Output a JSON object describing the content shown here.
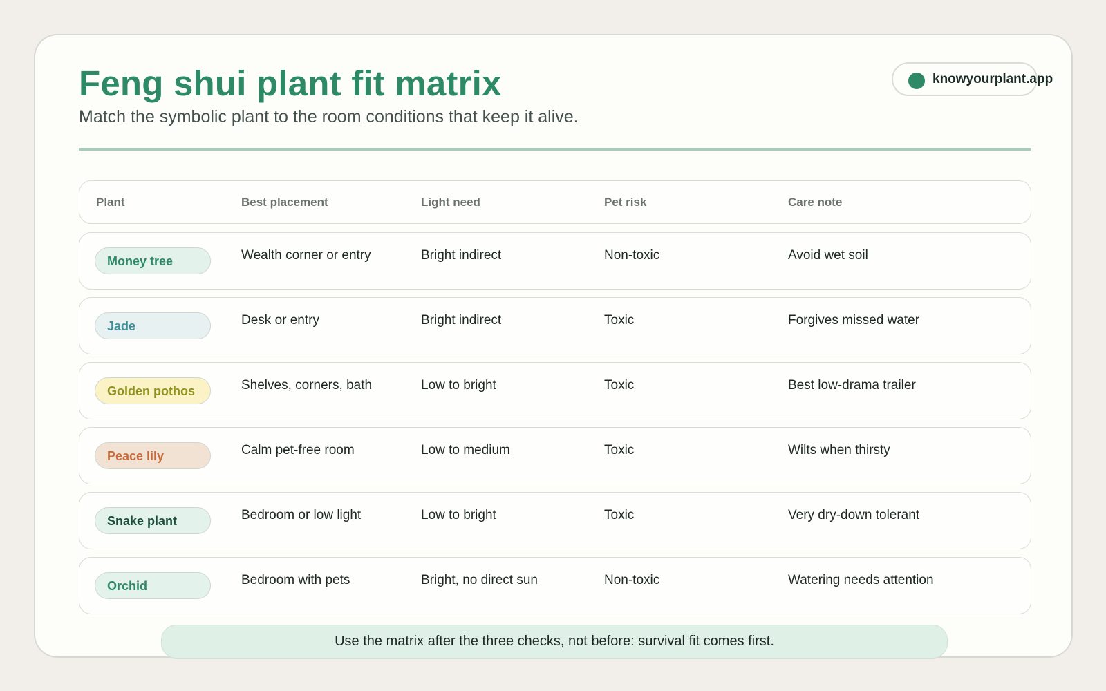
{
  "header": {
    "title": "Feng shui plant fit matrix",
    "subtitle": "Match the symbolic plant to the room conditions that keep it alive."
  },
  "brand": {
    "label": "knowyourplant.app",
    "dot_color": "#2e8a66"
  },
  "table": {
    "columns": [
      "Plant",
      "Best placement",
      "Light need",
      "Pet risk",
      "Care note"
    ],
    "rows": [
      {
        "plant": "Money tree",
        "placement": "Wealth corner or entry",
        "light": "Bright indirect",
        "pet_risk": "Non-toxic",
        "care": "Avoid wet soil",
        "pill_bg": "#e3f2ea",
        "pill_text": "#2e8a66"
      },
      {
        "plant": "Jade",
        "placement": "Desk or entry",
        "light": "Bright indirect",
        "pet_risk": "Toxic",
        "care": "Forgives missed water",
        "pill_bg": "#e8f1f2",
        "pill_text": "#3f8e98"
      },
      {
        "plant": "Golden pothos",
        "placement": "Shelves, corners, bath",
        "light": "Low to bright",
        "pet_risk": "Toxic",
        "care": "Best low-drama trailer",
        "pill_bg": "#fbf3c6",
        "pill_text": "#8e931f"
      },
      {
        "plant": "Peace lily",
        "placement": "Calm pet-free room",
        "light": "Low to medium",
        "pet_risk": "Toxic",
        "care": "Wilts when thirsty",
        "pill_bg": "#f2e2d4",
        "pill_text": "#c86a3a"
      },
      {
        "plant": "Snake plant",
        "placement": "Bedroom or low light",
        "light": "Low to bright",
        "pet_risk": "Toxic",
        "care": "Very dry-down tolerant",
        "pill_bg": "#e3f2ea",
        "pill_text": "#1b4d38"
      },
      {
        "plant": "Orchid",
        "placement": "Bedroom with pets",
        "light": "Bright, no direct sun",
        "pet_risk": "Non-toxic",
        "care": "Watering needs attention",
        "pill_bg": "#e3f2ea",
        "pill_text": "#2e8a66"
      }
    ]
  },
  "footer": {
    "note": "Use the matrix after the three checks, not before: survival fit comes first."
  }
}
